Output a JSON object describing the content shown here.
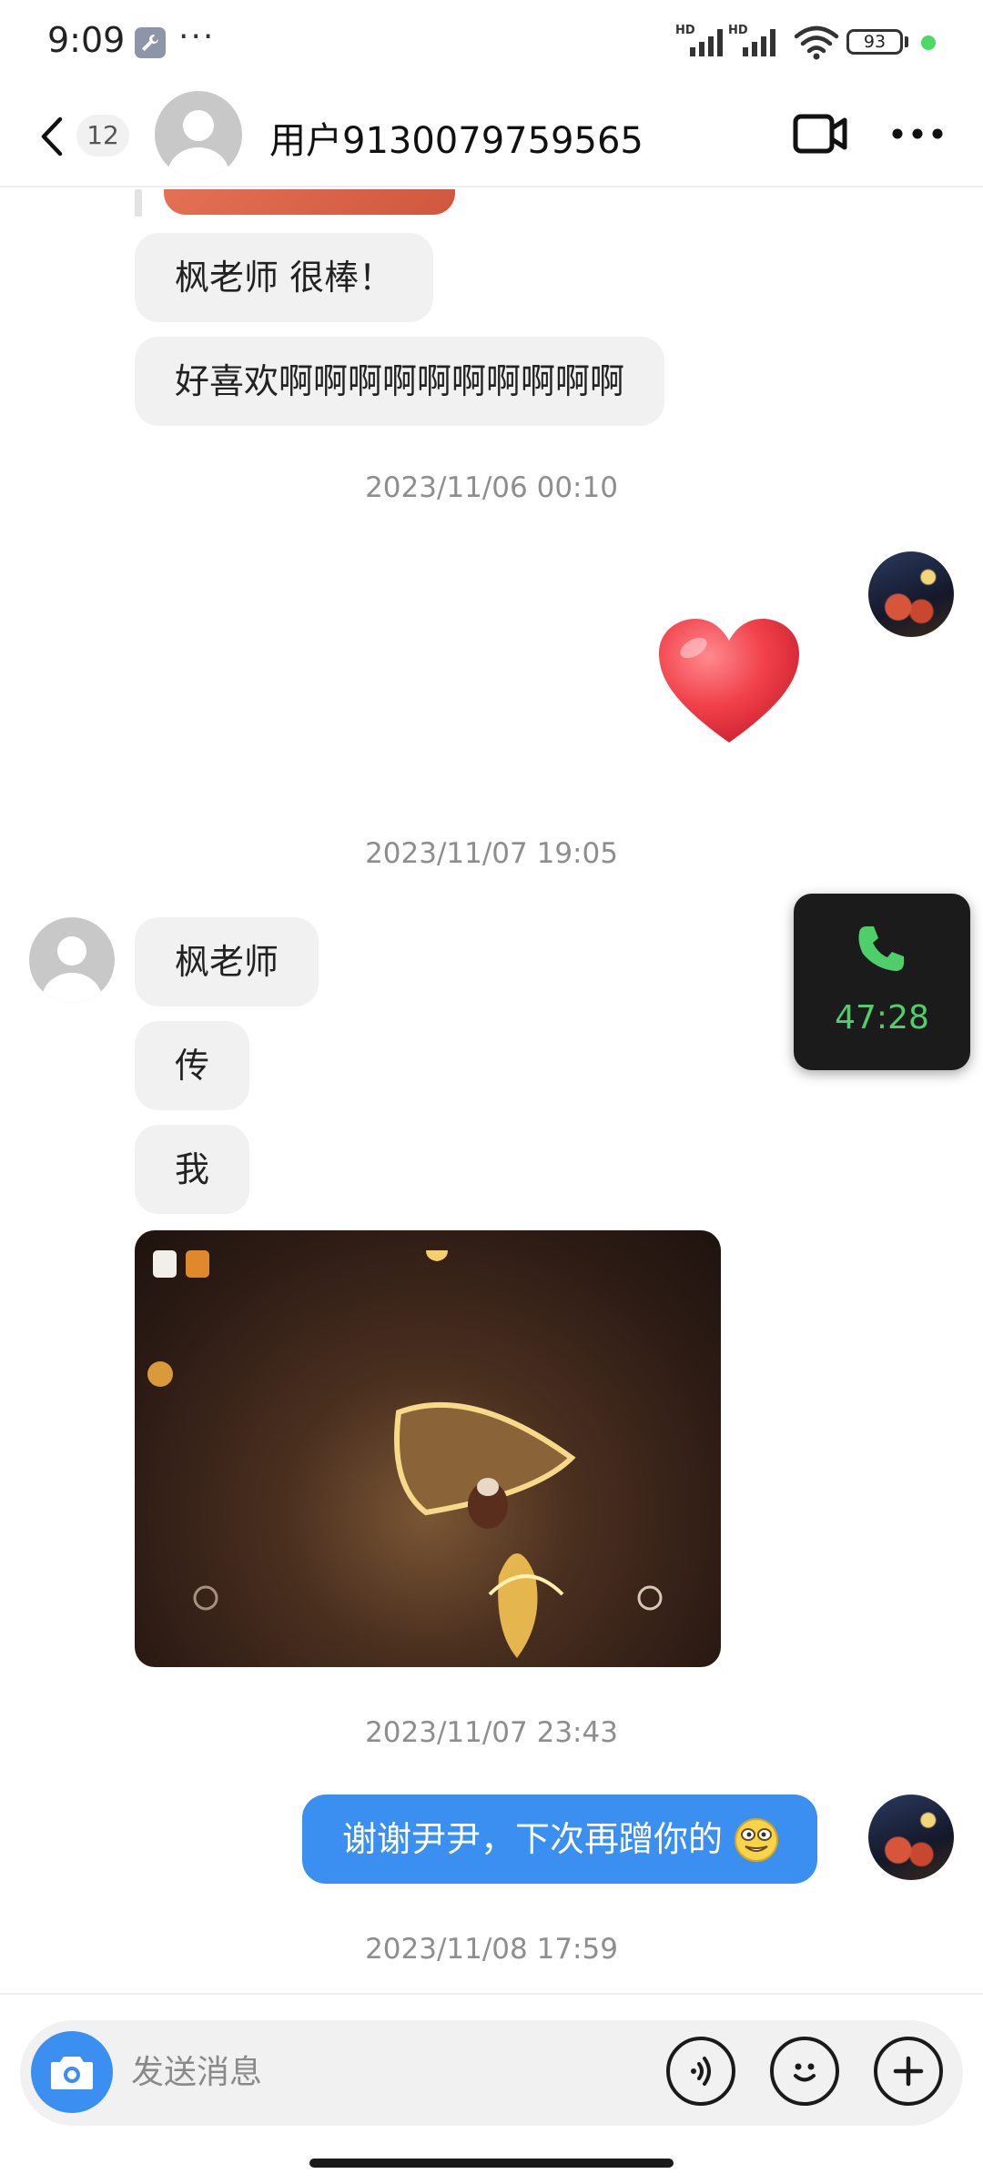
{
  "status_bar": {
    "time": "9:09",
    "more": "···",
    "battery": "93",
    "network_label": "HD"
  },
  "header": {
    "unread_count": "12",
    "title": "用户9130079759565"
  },
  "messages": {
    "m1": "枫老师 很棒！",
    "m2": "好喜欢啊啊啊啊啊啊啊啊啊啊",
    "ts1": "2023/11/06 00:10",
    "ts2": "2023/11/07 19:05",
    "m3": "枫老师",
    "m4": "传",
    "m5": "我",
    "ts3": "2023/11/07 23:43",
    "m6": "谢谢尹尹，下次再蹭你的",
    "ts4": "2023/11/08 17:59"
  },
  "call_widget": {
    "duration": "47:28"
  },
  "composer": {
    "placeholder": "发送消息"
  },
  "colors": {
    "accent": "#3a8ff0",
    "call_green": "#4fcf6a",
    "bubble_in": "#f1f1f1",
    "timestamp": "#8e8e8e"
  }
}
